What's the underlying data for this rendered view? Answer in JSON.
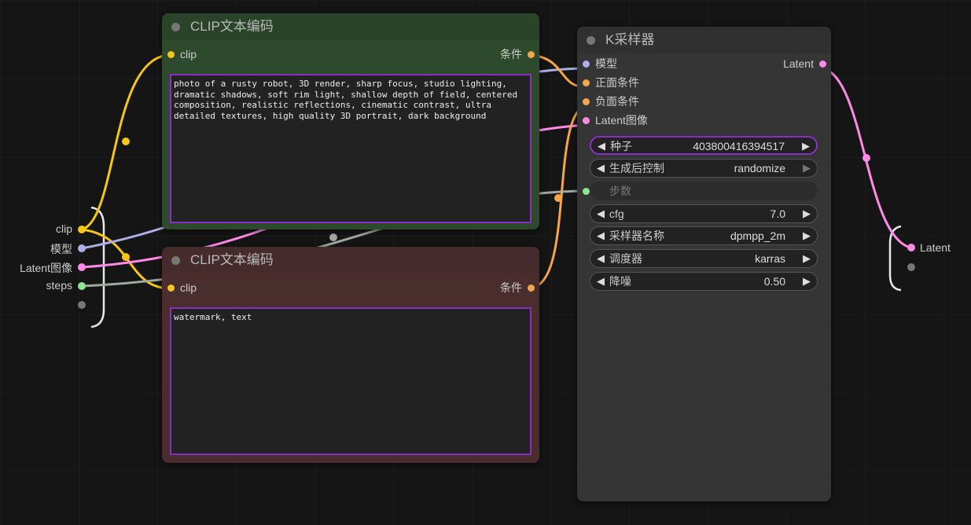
{
  "colors": {
    "clip": "#f5c518",
    "model": "#aeaee8",
    "latent": "#ff8ae6",
    "int": "#8de88d",
    "cond": "#f5a54a",
    "disabled": "#777777",
    "positive_node_bg": "#2d4a2d",
    "negative_node_bg": "#4a2e2e",
    "sampler_bg": "#353535",
    "focus_border": "#8a2ec4"
  },
  "positive_node": {
    "title": "CLIP文本编码",
    "input_label": "clip",
    "output_label": "条件",
    "text": "photo of a rusty robot, 3D render, sharp focus, studio lighting, dramatic shadows, soft rim light, shallow depth of field, centered composition, realistic reflections, cinematic contrast, ultra detailed textures, high quality 3D portrait, dark background"
  },
  "negative_node": {
    "title": "CLIP文本编码",
    "input_label": "clip",
    "output_label": "条件",
    "text": "watermark, text"
  },
  "sampler": {
    "title": "K采样器",
    "inputs": [
      {
        "label": "模型",
        "type": "model"
      },
      {
        "label": "正面条件",
        "type": "cond"
      },
      {
        "label": "负面条件",
        "type": "cond"
      },
      {
        "label": "Latent图像",
        "type": "latent"
      }
    ],
    "output_label": "Latent",
    "widgets": [
      {
        "name": "种子",
        "value": "403800416394517"
      },
      {
        "name": "生成后控制",
        "value": "randomize"
      },
      {
        "name": "步数",
        "value": ""
      },
      {
        "name": "cfg",
        "value": "7.0"
      },
      {
        "name": "采样器名称",
        "value": "dpmpp_2m"
      },
      {
        "name": "调度器",
        "value": "karras"
      },
      {
        "name": "降噪",
        "value": "0.50"
      }
    ]
  },
  "left_group": {
    "slots": [
      {
        "label": "clip",
        "type": "clip"
      },
      {
        "label": "模型",
        "type": "model"
      },
      {
        "label": "Latent图像",
        "type": "latent"
      },
      {
        "label": "steps",
        "type": "int"
      },
      {
        "label": "",
        "type": "empty"
      }
    ]
  },
  "right_group": {
    "slots": [
      {
        "label": "Latent",
        "type": "latent"
      },
      {
        "label": "",
        "type": "empty"
      }
    ]
  },
  "icons": {
    "arrow_left": "◀",
    "arrow_right": "▶"
  }
}
